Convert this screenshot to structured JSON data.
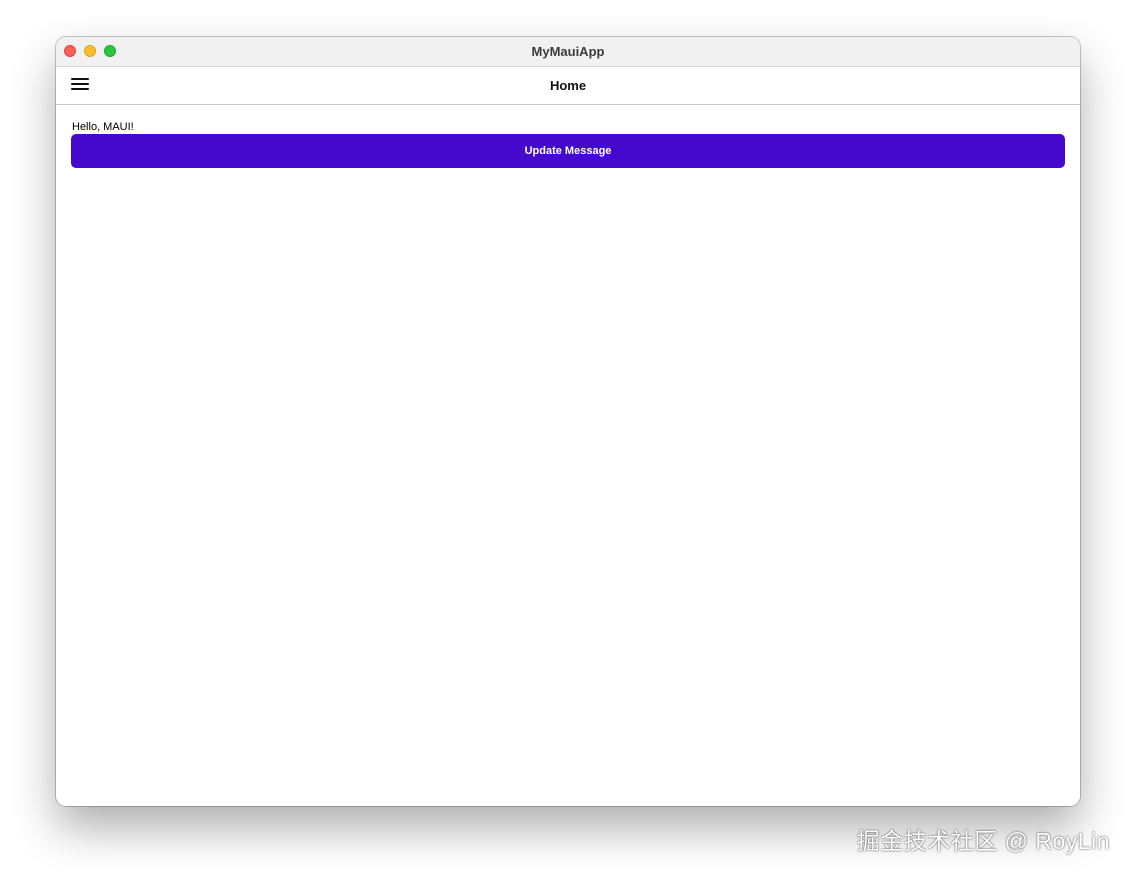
{
  "window": {
    "title": "MyMauiApp"
  },
  "navbar": {
    "title": "Home",
    "menu_icon": "hamburger-menu-icon"
  },
  "main": {
    "message": "Hello, MAUI!",
    "update_button_label": "Update Message"
  },
  "watermark": {
    "text": "掘金技术社区 @ RoyLin"
  },
  "colors": {
    "accent": "#4409cc",
    "titlebar": "#f2f1f2",
    "close": "#ff5f57",
    "minimize": "#febc2e",
    "zoom": "#28c840"
  }
}
